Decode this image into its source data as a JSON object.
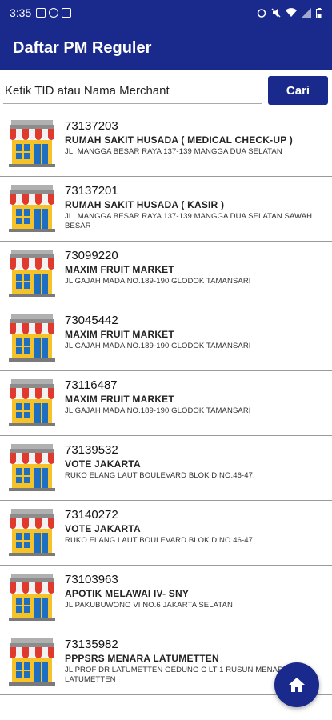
{
  "status_bar": {
    "time": "3:35"
  },
  "app_bar": {
    "title": "Daftar PM Reguler"
  },
  "search": {
    "placeholder": "Ketik TID atau Nama Merchant",
    "button_label": "Cari"
  },
  "merchants": [
    {
      "tid": "73137203",
      "name": "RUMAH SAKIT HUSADA ( MEDICAL CHECK-UP )",
      "address": "JL. MANGGA BESAR RAYA 137-139 MANGGA DUA SELATAN",
      "icon": "shop-icon"
    },
    {
      "tid": "73137201",
      "name": "RUMAH SAKIT HUSADA ( KASIR )",
      "address": "JL. MANGGA BESAR RAYA 137-139 MANGGA DUA SELATAN SAWAH BESAR",
      "icon": "shop-icon"
    },
    {
      "tid": "73099220",
      "name": "MAXIM FRUIT MARKET",
      "address": "JL GAJAH MADA NO.189-190 GLODOK TAMANSARI",
      "icon": "shop-icon"
    },
    {
      "tid": "73045442",
      "name": "MAXIM FRUIT MARKET",
      "address": "JL GAJAH MADA NO.189-190 GLODOK TAMANSARI",
      "icon": "shop-icon"
    },
    {
      "tid": "73116487",
      "name": "MAXIM FRUIT MARKET",
      "address": "JL GAJAH MADA NO.189-190 GLODOK TAMANSARI",
      "icon": "shop-icon"
    },
    {
      "tid": "73139532",
      "name": "VOTE JAKARTA",
      "address": "RUKO ELANG LAUT BOULEVARD BLOK D NO.46-47,",
      "icon": "shop-icon"
    },
    {
      "tid": "73140272",
      "name": "VOTE JAKARTA",
      "address": "RUKO ELANG LAUT BOULEVARD BLOK D NO.46-47,",
      "icon": "shop-icon"
    },
    {
      "tid": "73103963",
      "name": "APOTIK MELAWAI IV- SNY",
      "address": "JL PAKUBUWONO VI NO.6 JAKARTA SELATAN",
      "icon": "shop-icon"
    },
    {
      "tid": "73135982",
      "name": "PPPSRS MENARA LATUMETTEN",
      "address": "JL PROF DR LATUMETTEN GEDUNG C LT 1 RUSUN MENARA LATUMETTEN",
      "icon": "shop-icon"
    }
  ],
  "fab": {
    "icon": "home-icon"
  },
  "colors": {
    "primary": "#1a2a8c",
    "divider": "#9a9a9a"
  }
}
